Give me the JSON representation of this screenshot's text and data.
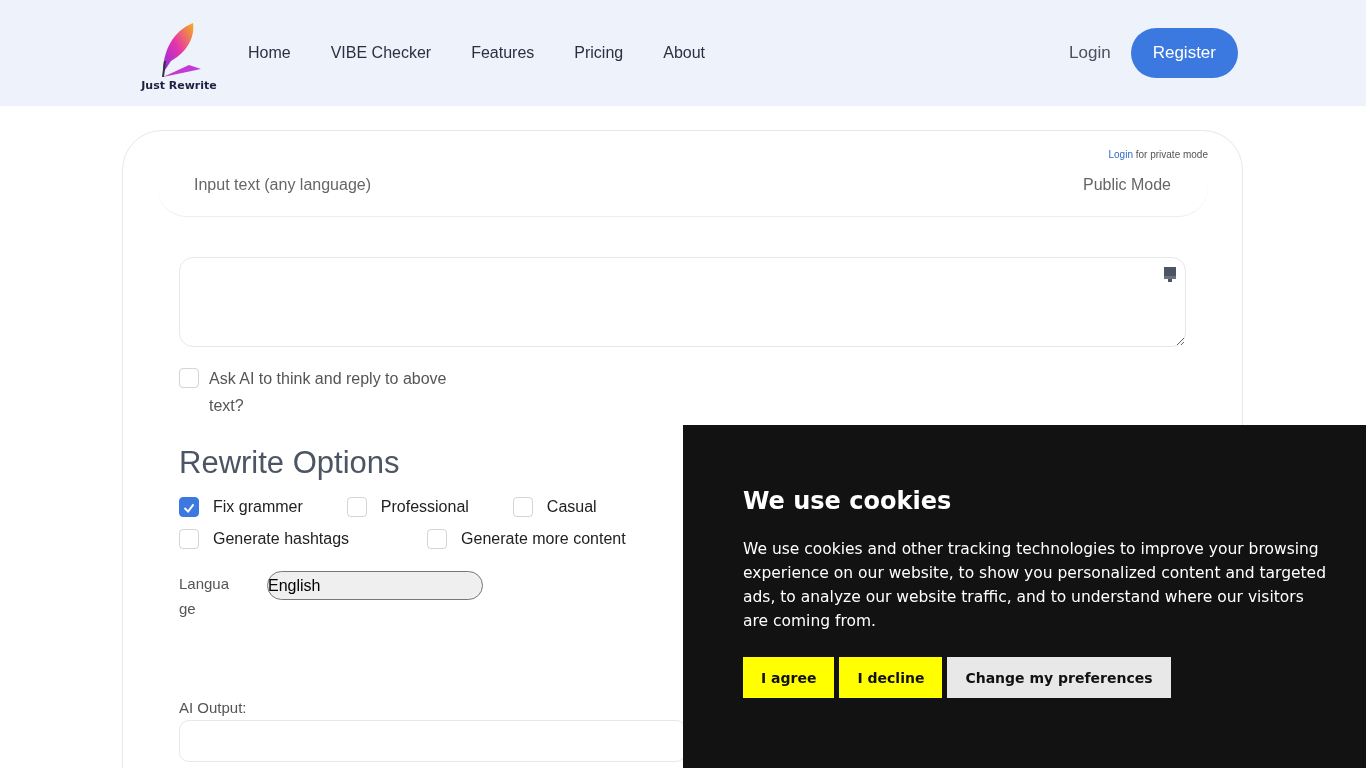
{
  "header": {
    "logo_text": "Just Rewrite",
    "nav": [
      {
        "label": "Home"
      },
      {
        "label": "VIBE Checker"
      },
      {
        "label": "Features"
      },
      {
        "label": "Pricing"
      },
      {
        "label": "About"
      }
    ],
    "login": "Login",
    "register": "Register"
  },
  "input_panel": {
    "login_link": "Login",
    "login_note": "for private mode",
    "input_label": "Input text (any language)",
    "mode": "Public Mode"
  },
  "think_option": {
    "label": "Ask AI to think and reply to above text?",
    "checked": false
  },
  "rewrite_options": {
    "title": "Rewrite Options",
    "options": [
      {
        "label": "Fix grammer",
        "checked": true
      },
      {
        "label": "Professional",
        "checked": false
      },
      {
        "label": "Casual",
        "checked": false
      },
      {
        "label": "Generate hashtags",
        "checked": false
      },
      {
        "label": "Generate more content",
        "checked": false
      }
    ]
  },
  "language": {
    "label": "Language",
    "value": "English"
  },
  "output": {
    "label": "AI Output:"
  },
  "cookie_banner": {
    "title": "We use cookies",
    "text": "We use cookies and other tracking technologies to improve your browsing experience on our website, to show you personalized content and targeted ads, to analyze our website traffic, and to understand where our visitors are coming from.",
    "buttons": [
      {
        "label": "I agree",
        "kind": "accent"
      },
      {
        "label": "I decline",
        "kind": "accent"
      },
      {
        "label": "Change my preferences",
        "kind": "plain"
      }
    ]
  }
}
